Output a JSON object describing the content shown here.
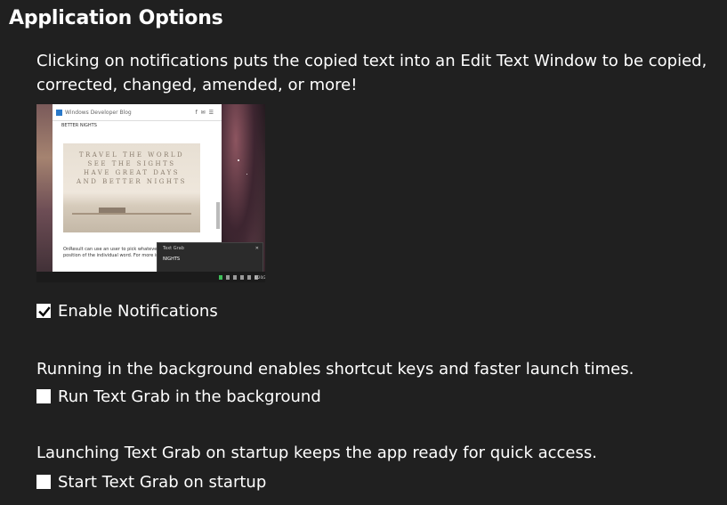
{
  "page": {
    "title": "Application Options"
  },
  "notifications": {
    "description": "Clicking on notifications puts the copied text into an Edit Text Window to be copied, corrected, changed, amended, or more!",
    "checkbox_label": "Enable Notifications",
    "checked": true
  },
  "preview": {
    "browser_title": "Windows Developer Blog",
    "crumb": "BETTER NIGHTS",
    "hero_lines": [
      "TRAVEL THE WORLD",
      "SEE THE SIGHTS",
      "HAVE GREAT DAYS",
      "AND BETTER NIGHTS"
    ],
    "body_text": "OnResult can use an user to pick whatever text is in position of the individual word. For more info.",
    "toast_title": "Text Grab",
    "toast_body": "NIGHTS",
    "toast_close": "✕",
    "clock": "4/20/2021"
  },
  "background": {
    "description": "Running in the background enables shortcut keys and faster launch times.",
    "checkbox_label": "Run Text Grab in the background",
    "checked": false
  },
  "startup": {
    "description": "Launching Text Grab on startup keeps the app ready for quick access.",
    "checkbox_label": "Start Text Grab on startup",
    "checked": false
  },
  "colors": {
    "background": "#202020",
    "text": "#ffffff",
    "checkmark": "#000000"
  }
}
